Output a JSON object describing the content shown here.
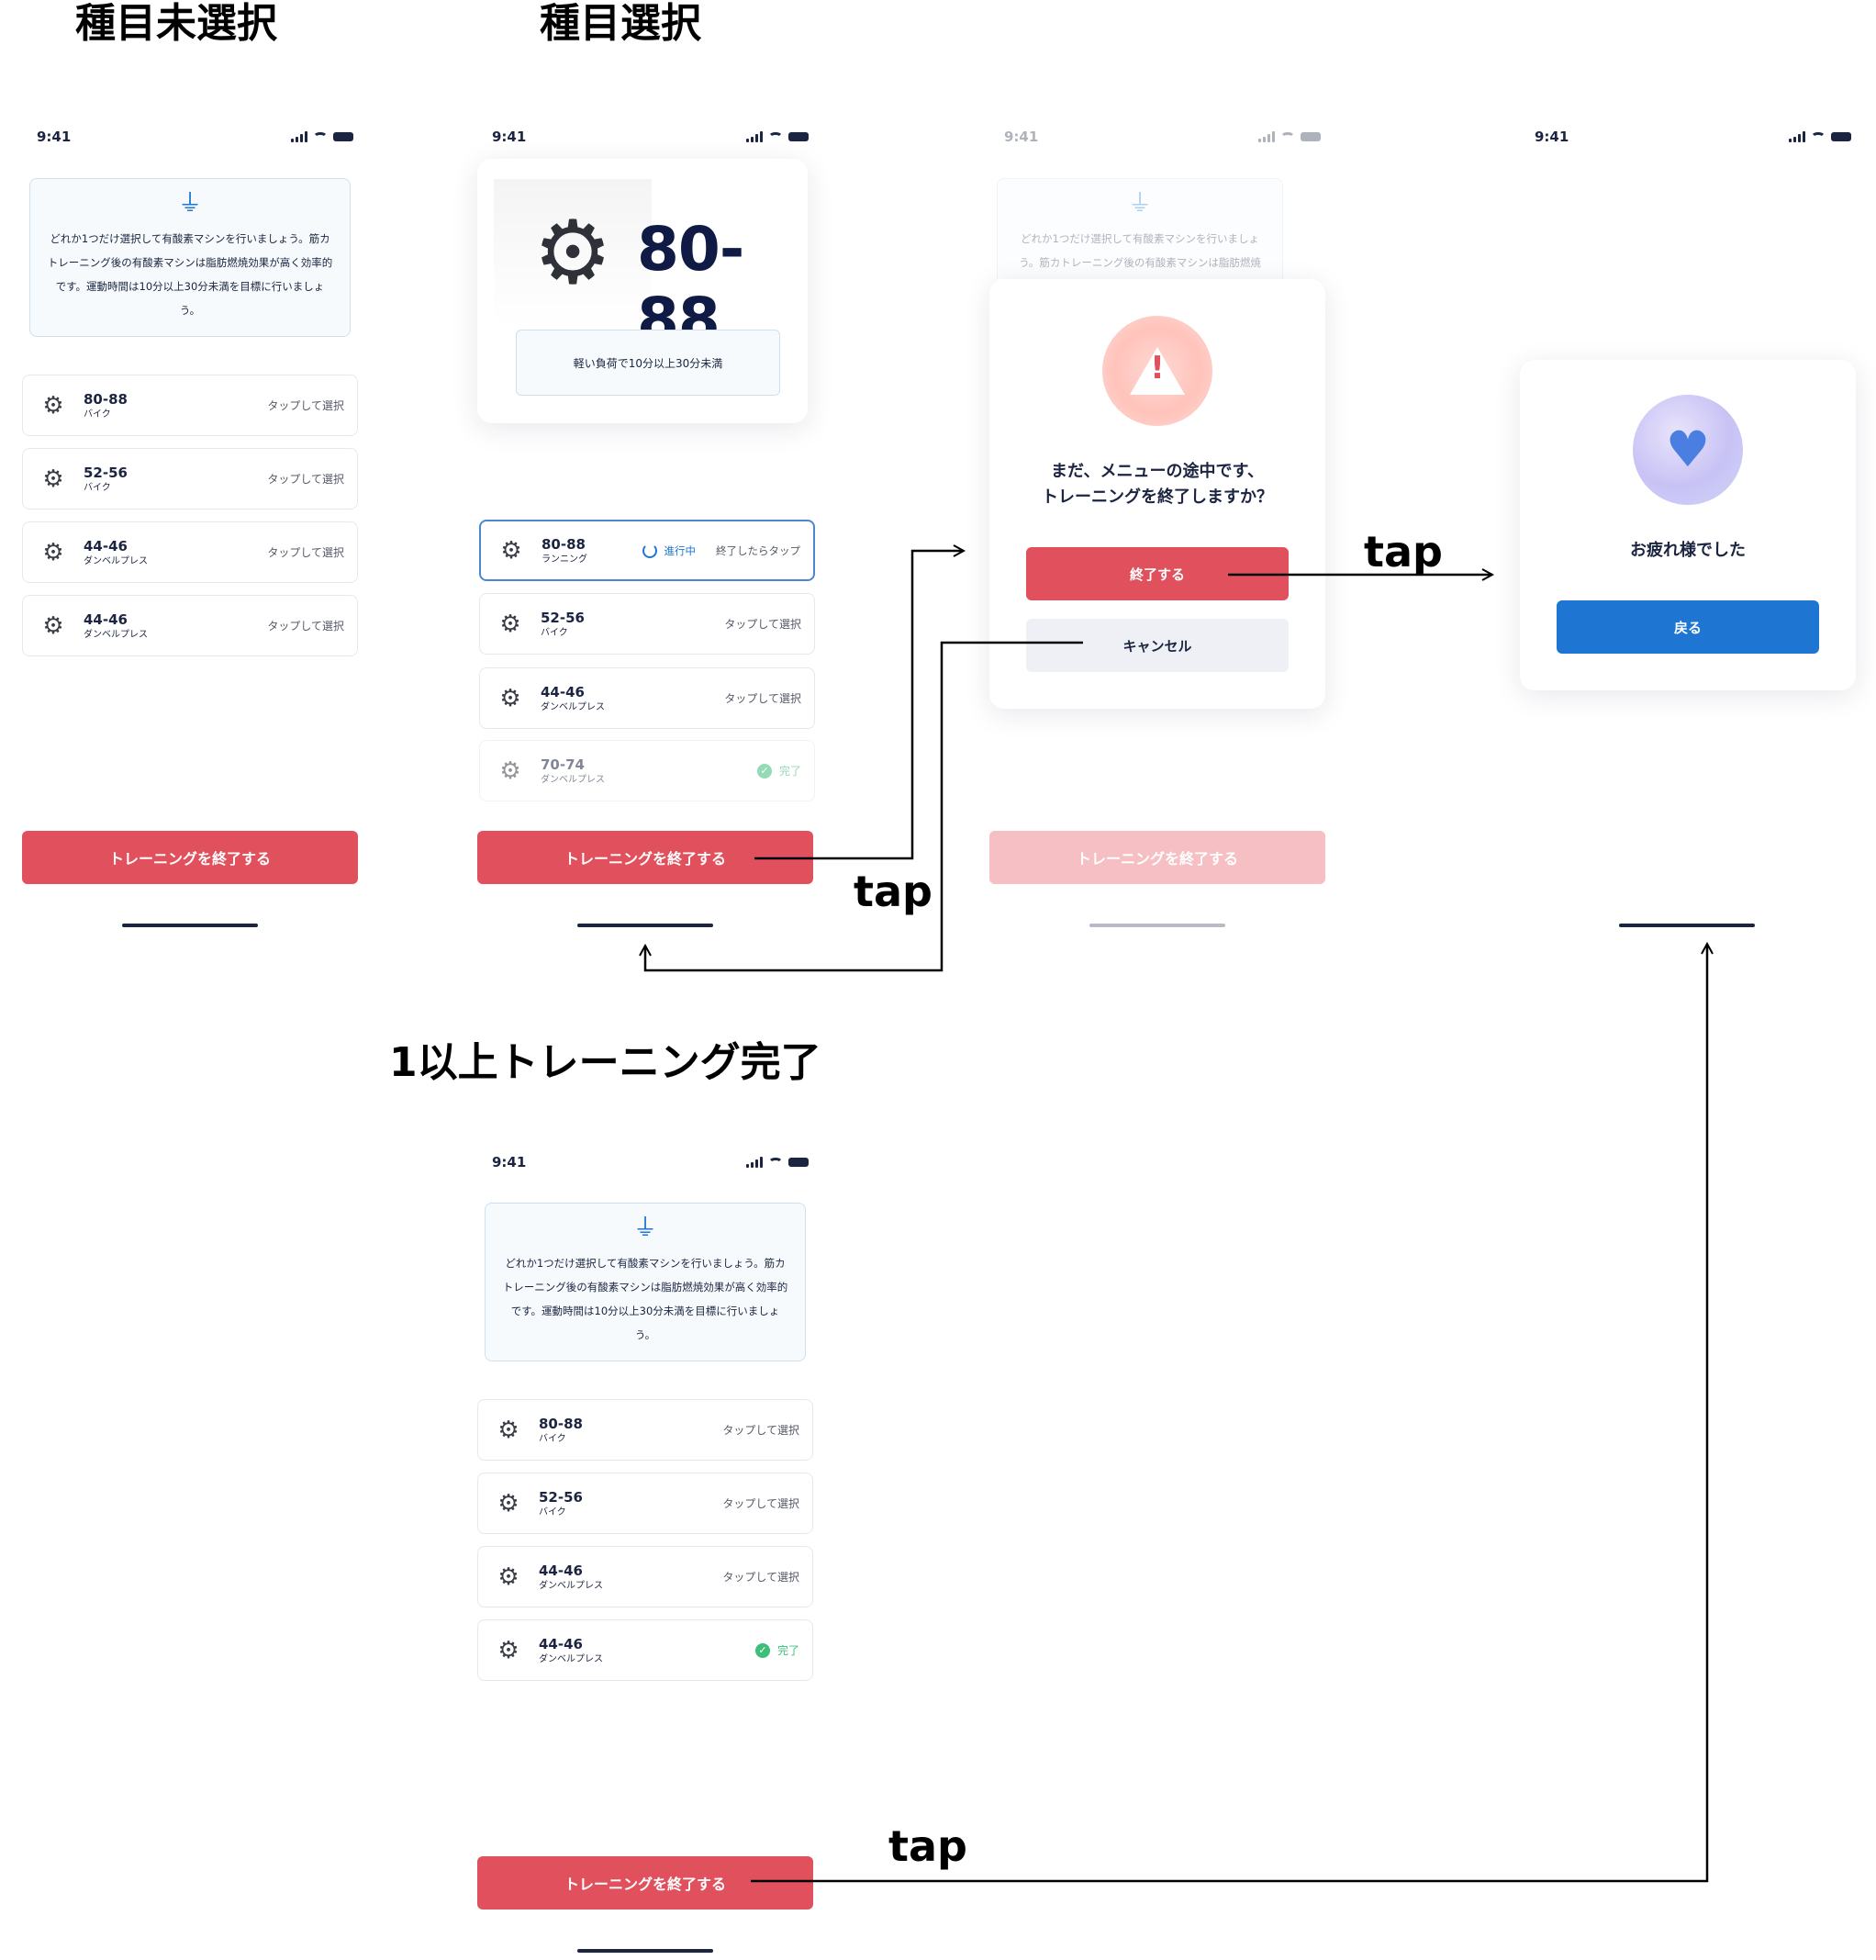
{
  "headings": {
    "unselected": "種目未選択",
    "selected": "種目選択",
    "completed_one_or_more": "1以上トレーニング完了"
  },
  "tap_label": "tap",
  "status_bar": {
    "time": "9:41"
  },
  "info_box": {
    "icon": "treadmill-icon",
    "text": "どれか1つだけ選択して有酸素マシンを行いましょう。筋カトレーニング後の有酸素マシンは脂肪燃焼効果が高く効率的です。運動時間は10分以上30分未満を目標に行いましょう。"
  },
  "screen1": {
    "items": [
      {
        "name": "80-88",
        "sub": "バイク",
        "right": "タップして選択"
      },
      {
        "name": "52-56",
        "sub": "バイク",
        "right": "タップして選択"
      },
      {
        "name": "44-46",
        "sub": "ダンベルプレス",
        "right": "タップして選択"
      },
      {
        "name": "44-46",
        "sub": "ダンベルプレス",
        "right": "タップして選択"
      }
    ]
  },
  "screen2": {
    "machine_number": "80-88",
    "load_text": "軽い負荷で10分以上30分未満",
    "items": [
      {
        "name": "80-88",
        "sub": "ランニング",
        "status": "進行中",
        "after": "終了したらタップ"
      },
      {
        "name": "52-56",
        "sub": "バイク",
        "right": "タップして選択"
      },
      {
        "name": "44-46",
        "sub": "ダンベルプレス",
        "right": "タップして選択"
      },
      {
        "name": "70-74",
        "sub": "ダンベルプレス",
        "done": "完了"
      }
    ]
  },
  "screen3": {
    "dialog_text_1": "まだ、メニューの途中です、",
    "dialog_text_2": "トレーニングを終了しますか？",
    "confirm": "終了する",
    "cancel": "キャンセル"
  },
  "screen4": {
    "message": "お疲れ様でした",
    "back": "戻る"
  },
  "screen5": {
    "items": [
      {
        "name": "80-88",
        "sub": "バイク",
        "right": "タップして選択"
      },
      {
        "name": "52-56",
        "sub": "バイク",
        "right": "タップして選択"
      },
      {
        "name": "44-46",
        "sub": "ダンベルプレス",
        "right": "タップして選択"
      },
      {
        "name": "44-46",
        "sub": "ダンベルプレス",
        "done": "完了"
      }
    ]
  },
  "end_training_button": "トレーニングを終了する",
  "colors": {
    "accent_red": "#e0515d",
    "accent_blue": "#1f76d2",
    "done_green": "#3bbf7a"
  }
}
